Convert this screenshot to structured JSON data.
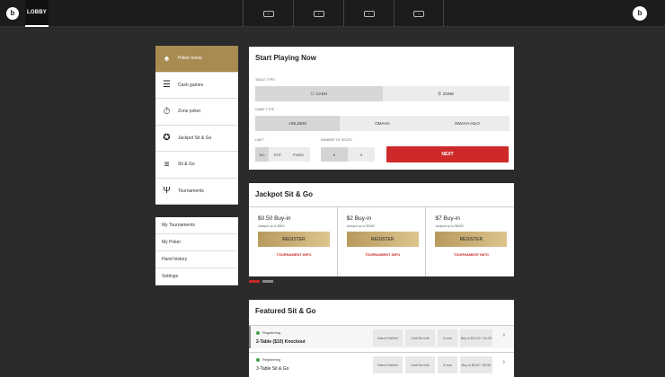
{
  "topbar": {
    "logo_letter": "b",
    "lobby_label": "LOBBY",
    "tab_slots": [
      "+",
      "+",
      "+",
      "+"
    ],
    "account_letter": "b"
  },
  "sidebar": {
    "items": [
      {
        "label": "Poker home",
        "icon": "cards-icon",
        "glyph": "♠"
      },
      {
        "label": "Cash games",
        "icon": "chips-icon",
        "glyph": "☰"
      },
      {
        "label": "Zone poker",
        "icon": "stopwatch-icon",
        "glyph": "⏱"
      },
      {
        "label": "Jackpot Sit & Go",
        "icon": "jackpot-icon",
        "glyph": "✪"
      },
      {
        "label": "Sit & Go",
        "icon": "chip-stack-icon",
        "glyph": "≡"
      },
      {
        "label": "Tournaments",
        "icon": "trophy-icon",
        "glyph": "Ψ"
      }
    ],
    "secondary": [
      "My Tournaments",
      "My Poker",
      "Hand history",
      "Settings"
    ]
  },
  "start_playing": {
    "title": "Start Playing Now",
    "table_type_label": "TABLE TYPE",
    "table_types": [
      "CASH",
      "ZONE"
    ],
    "game_type_label": "GAME TYPE",
    "game_types": [
      "HOLDEM",
      "OMAHA",
      "OMAHA HILO"
    ],
    "limit_label": "LIMIT",
    "limits": [
      "NO",
      "POT",
      "FIXED"
    ],
    "seats_label": "NUMBER OF SEATS",
    "seats": [
      "6",
      "9"
    ],
    "next_label": "NEXT"
  },
  "jackpot": {
    "title": "Jackpot Sit & Go",
    "cards": [
      {
        "buyin": "$0.50 Buy-in",
        "jackpot": "Jackpot up to $500",
        "register": "REGISTER",
        "info": "TOURNAMENT INFO"
      },
      {
        "buyin": "$2 Buy-in",
        "jackpot": "Jackpot up to $2400",
        "register": "REGISTER",
        "info": "TOURNAMENT INFO"
      },
      {
        "buyin": "$7 Buy-in",
        "jackpot": "Jackpot up to $8400",
        "register": "REGISTER",
        "info": "TOURNAMENT INFO"
      }
    ]
  },
  "featured": {
    "title": "Featured Sit & Go",
    "rows": [
      {
        "status": "Registering",
        "name": "2-Table ($10) Knockout",
        "cells": [
          "Game Hold'em",
          "Limit No limit",
          "6 max",
          "Buy-in $10.00 + $1.00"
        ]
      },
      {
        "status": "Registering",
        "name": "3-Table Sit & Go",
        "cells": [
          "Game Hold'em",
          "Limit No limit",
          "6 max",
          "Buy-in $5.00 + $0.50"
        ]
      }
    ]
  },
  "colors": {
    "accent_gold": "#a78b50",
    "next_red": "#cf2a2a",
    "status_green": "#43a047"
  }
}
